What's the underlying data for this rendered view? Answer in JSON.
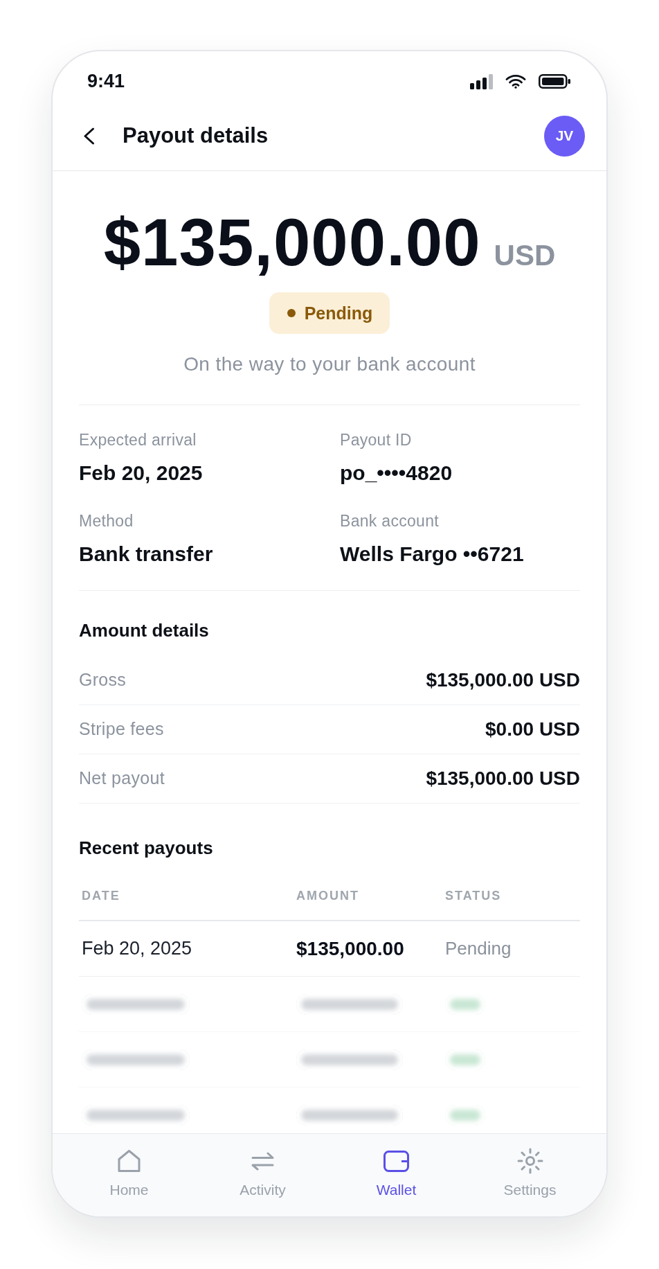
{
  "status_bar": {
    "time": "9:41"
  },
  "header": {
    "title": "Payout details",
    "avatar_initials": "JV"
  },
  "summary": {
    "amount": "$135,000.00",
    "currency": "USD",
    "status": "Pending",
    "message": "On the way to your bank account"
  },
  "details": [
    {
      "label": "Expected arrival",
      "value": "Feb 20, 2025"
    },
    {
      "label": "Payout ID",
      "value": "po_••••4820"
    },
    {
      "label": "Method",
      "value": "Bank transfer"
    },
    {
      "label": "Bank account",
      "value": "Wells Fargo ••6721"
    }
  ],
  "amount_details": {
    "title": "Amount details",
    "rows": [
      {
        "label": "Gross",
        "value": "$135,000.00 USD"
      },
      {
        "label": "Stripe fees",
        "value": "$0.00 USD"
      },
      {
        "label": "Net payout",
        "value": "$135,000.00 USD"
      }
    ]
  },
  "recent_payouts": {
    "title": "Recent payouts",
    "columns": [
      "DATE",
      "AMOUNT",
      "STATUS"
    ],
    "rows": [
      {
        "kind": "payout",
        "date": "Feb 20, 2025",
        "amount": "$135,000.00",
        "status": "Pending",
        "color": "#8b929c"
      },
      {
        "kind": "blurred",
        "color": "#c9e7d4"
      },
      {
        "kind": "blurred",
        "color": "#c9e7d4"
      },
      {
        "kind": "blurred",
        "color": "#c9e7d4"
      }
    ]
  },
  "bottom_nav": [
    {
      "label": "Home",
      "selected": false
    },
    {
      "label": "Activity",
      "selected": false
    },
    {
      "label": "Wallet",
      "selected": true
    },
    {
      "label": "Settings",
      "selected": false
    }
  ]
}
